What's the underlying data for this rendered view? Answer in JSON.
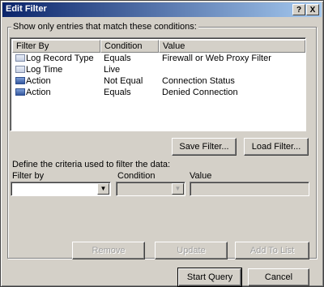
{
  "window": {
    "title": "Edit Filter",
    "help_glyph": "?",
    "close_glyph": "X"
  },
  "group": {
    "legend": "Show only entries that match these conditions:"
  },
  "filters": {
    "columns": [
      "Filter By",
      "Condition",
      "Value"
    ],
    "rows": [
      {
        "icon": "filter-row-icon",
        "active": false,
        "filter_by": "Log Record Type",
        "condition": "Equals",
        "value": "Firewall or Web Proxy Filter"
      },
      {
        "icon": "filter-row-icon",
        "active": false,
        "filter_by": "Log Time",
        "condition": "Live",
        "value": ""
      },
      {
        "icon": "filter-row-active-icon",
        "active": true,
        "filter_by": "Action",
        "condition": "Not Equal",
        "value": "Connection Status"
      },
      {
        "icon": "filter-row-active-icon",
        "active": true,
        "filter_by": "Action",
        "condition": "Equals",
        "value": "Denied Connection"
      }
    ]
  },
  "buttons": {
    "save_filter": "Save Filter...",
    "load_filter": "Load Filter...",
    "remove": "Remove",
    "update": "Update",
    "add_to_list": "Add To List",
    "start_query": "Start Query",
    "cancel": "Cancel"
  },
  "criteria": {
    "heading": "Define the criteria used to filter the data:",
    "filter_by_label": "Filter by",
    "condition_label": "Condition",
    "value_label": "Value",
    "filter_by_value": "",
    "condition_value": "",
    "value_value": ""
  },
  "colors": {
    "face": "#d4d0c8",
    "title_start": "#0a246a",
    "title_end": "#a6caf0"
  }
}
